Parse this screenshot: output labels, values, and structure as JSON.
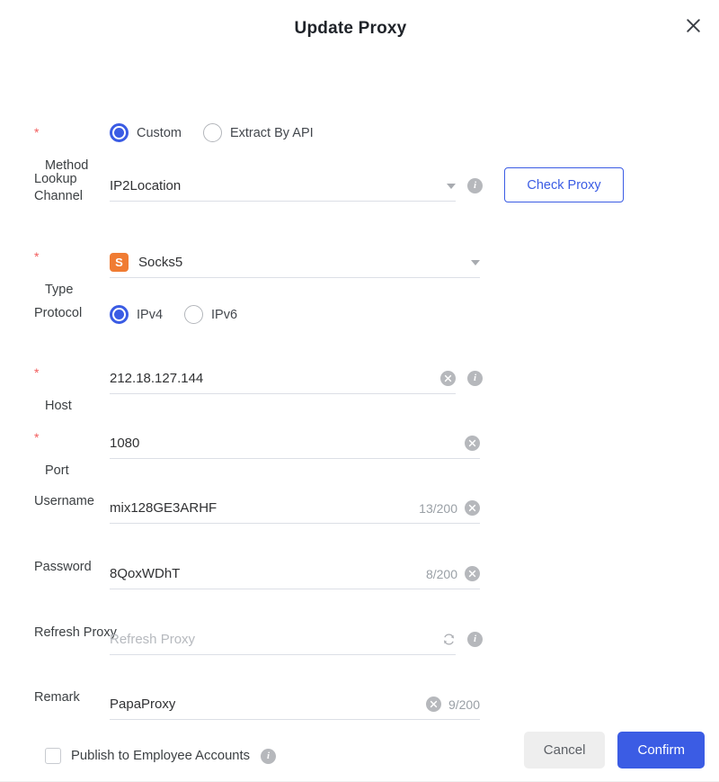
{
  "dialog": {
    "title": "Update Proxy",
    "close_icon": "close-icon"
  },
  "colors": {
    "accent": "#3b5ce4",
    "required": "#f25c5c",
    "badge_orange": "#f07c33",
    "muted": "#9aa0a6",
    "cancel_bg": "#eeeeee"
  },
  "fields": {
    "method": {
      "label": "Method",
      "required": "*",
      "options": [
        {
          "label": "Custom",
          "selected": true
        },
        {
          "label": "Extract By API",
          "selected": false
        }
      ]
    },
    "lookup_channel": {
      "label": "Lookup\nChannel",
      "value": "IP2Location",
      "info_icon": "info-icon",
      "caret_icon": "chevron-down-icon"
    },
    "check_proxy": {
      "label": "Check Proxy"
    },
    "type": {
      "label": "Type",
      "required": "*",
      "badge": "S",
      "value": "Socks5",
      "caret_icon": "chevron-down-icon"
    },
    "protocol": {
      "label": "Protocol",
      "options": [
        {
          "label": "IPv4",
          "selected": true
        },
        {
          "label": "IPv6",
          "selected": false
        }
      ]
    },
    "host": {
      "label": "Host",
      "required": "*",
      "value": "212.18.127.144",
      "clear_icon": "clear-icon",
      "info_icon": "info-icon"
    },
    "port": {
      "label": "Port",
      "required": "*",
      "value": "1080",
      "clear_icon": "clear-icon"
    },
    "username": {
      "label": "Username",
      "value": "mix128GE3ARHF",
      "counter": "13/200",
      "clear_icon": "clear-icon"
    },
    "password": {
      "label": "Password",
      "value": "8QoxWDhT",
      "counter": "8/200",
      "clear_icon": "clear-icon"
    },
    "refresh_proxy": {
      "label": "Refresh Proxy",
      "placeholder": "Refresh Proxy",
      "refresh_icon": "refresh-icon",
      "info_icon": "info-icon"
    },
    "remark": {
      "label": "Remark",
      "value": "PapaProxy",
      "counter": "9/200",
      "clear_icon": "clear-icon"
    },
    "publish": {
      "label": "Publish to Employee Accounts",
      "checked": false,
      "info_icon": "info-icon"
    }
  },
  "footer": {
    "cancel_label": "Cancel",
    "confirm_label": "Confirm"
  }
}
